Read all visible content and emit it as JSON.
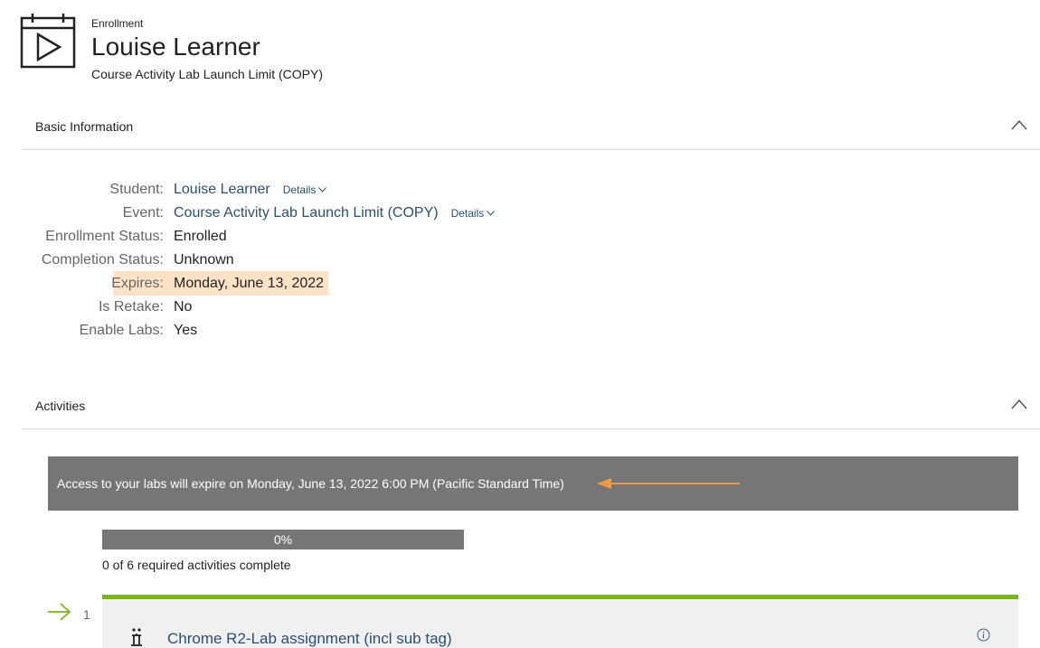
{
  "header": {
    "icon": "calendar-play-icon",
    "eyebrow": "Enrollment",
    "title": "Louise Learner",
    "subtitle": "Course Activity Lab Launch Limit (COPY)"
  },
  "basic_info": {
    "title": "Basic Information",
    "collapse_icon": "chevron-up-icon",
    "fields": {
      "student": {
        "label": "Student:",
        "value": "Louise Learner",
        "details": "Details"
      },
      "event": {
        "label": "Event:",
        "value": "Course Activity Lab Launch Limit (COPY)",
        "details": "Details"
      },
      "enrollment_status": {
        "label": "Enrollment Status:",
        "value": "Enrolled"
      },
      "completion_status": {
        "label": "Completion Status:",
        "value": "Unknown"
      },
      "expires": {
        "label": "Expires:",
        "value": "Monday, June 13, 2022"
      },
      "is_retake": {
        "label": "Is Retake:",
        "value": "No"
      },
      "enable_labs": {
        "label": "Enable Labs:",
        "value": "Yes"
      }
    },
    "highlight_color": "#fde2c7"
  },
  "activities": {
    "title": "Activities",
    "collapse_icon": "chevron-up-icon",
    "banner": {
      "text": "Access to your labs will expire on Monday, June 13, 2022 6:00 PM (Pacific Standard Time)",
      "background": "#767676",
      "annotation_arrow_color": "#f39a3d"
    },
    "progress": {
      "percent": 0,
      "label": "0%",
      "caption": "0 of 6 required activities complete"
    },
    "items": [
      {
        "number": "1",
        "title": "Chrome R2-Lab assignment (incl sub tag)",
        "type_icon": "lab-flask-icon",
        "status_icon": "arrow-right-icon",
        "info_icon": "info-icon",
        "accent_color": "#7cb518"
      }
    ]
  },
  "colors": {
    "link": "#2d4f73",
    "label": "#666666",
    "accent_green": "#7cb518"
  }
}
